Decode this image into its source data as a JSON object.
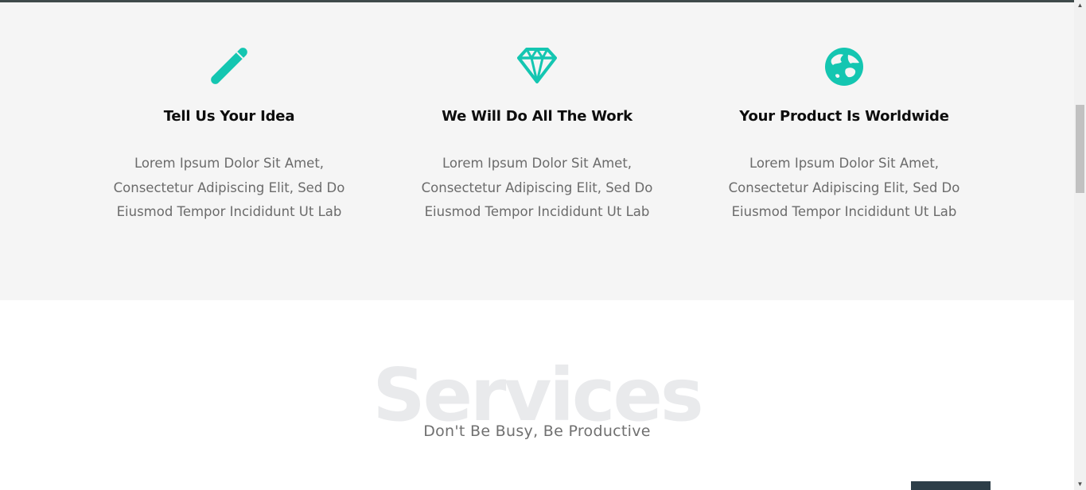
{
  "features": [
    {
      "icon": "pencil-icon",
      "title": "Tell Us Your Idea",
      "description": "Lorem Ipsum Dolor Sit Amet, Consectetur Adipiscing Elit, Sed Do Eiusmod Tempor Incididunt Ut Lab"
    },
    {
      "icon": "diamond-icon",
      "title": "We Will Do All The Work",
      "description": "Lorem Ipsum Dolor Sit Amet, Consectetur Adipiscing Elit, Sed Do Eiusmod Tempor Incididunt Ut Lab"
    },
    {
      "icon": "globe-icon",
      "title": "Your Product Is Worldwide",
      "description": "Lorem Ipsum Dolor Sit Amet, Consectetur Adipiscing Elit, Sed Do Eiusmod Tempor Incididunt Ut Lab"
    }
  ],
  "services": {
    "heading": "Services",
    "subheading": "Don't Be Busy, Be Productive"
  },
  "colors": {
    "accent": "#14c6b1",
    "features_background": "#f5f5f5",
    "dark_block": "#2d3e48"
  }
}
